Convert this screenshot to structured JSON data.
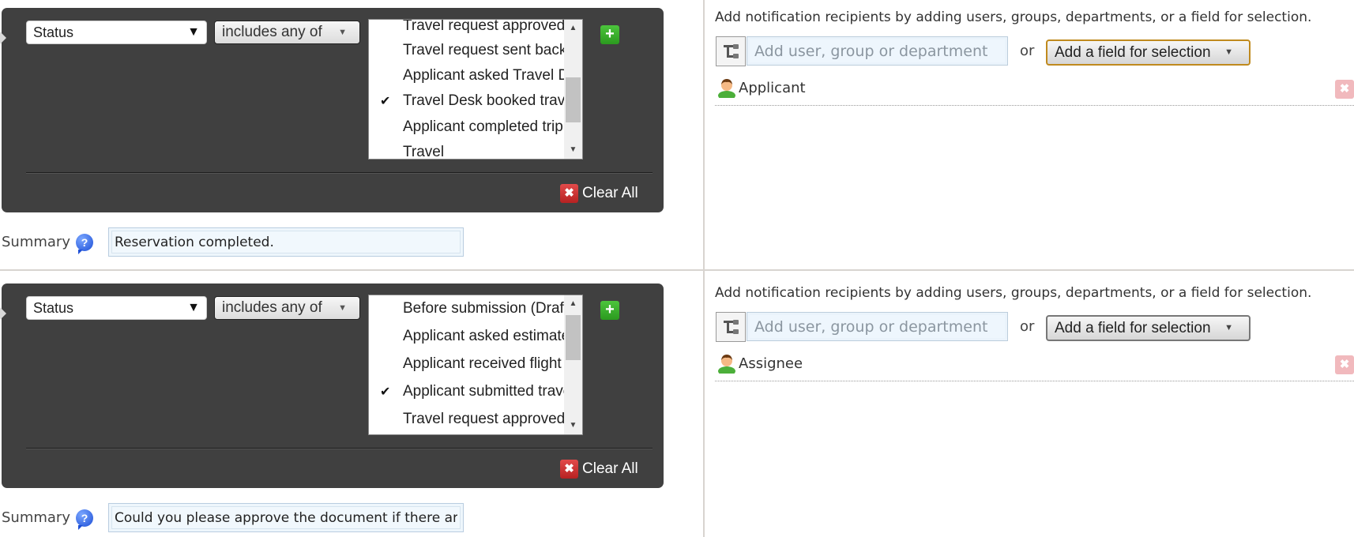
{
  "rules": [
    {
      "condition": {
        "field": "Status",
        "operator": "includes any of",
        "options": [
          {
            "label": "Travel request approved",
            "checked": false
          },
          {
            "label": "Travel request sent back",
            "checked": false
          },
          {
            "label": "Applicant asked Travel Desk",
            "checked": false
          },
          {
            "label": "Travel Desk booked travel",
            "checked": true
          },
          {
            "label": "Applicant completed trip",
            "checked": false
          },
          {
            "label": "Travel",
            "checked": false
          }
        ],
        "scroll_position": 0.55,
        "clear_all_label": "Clear All"
      },
      "summary": {
        "label": "Summary",
        "value": "Reservation completed."
      },
      "recipients": {
        "instructions": "Add notification recipients by adding users, groups, departments, or a field for selection.",
        "input_placeholder": "Add user, group or department",
        "or_label": "or",
        "field_button_label": "Add a field for selection",
        "list": [
          {
            "name": "Applicant"
          }
        ]
      }
    },
    {
      "condition": {
        "field": "Status",
        "operator": "includes any of",
        "options": [
          {
            "label": "Before submission (Draft)",
            "checked": false
          },
          {
            "label": "Applicant asked estimate",
            "checked": false
          },
          {
            "label": "Applicant received flight",
            "checked": false
          },
          {
            "label": "Applicant submitted travel",
            "checked": true
          },
          {
            "label": "Travel request approved",
            "checked": false
          }
        ],
        "scroll_position": 0.1,
        "clear_all_label": "Clear All"
      },
      "summary": {
        "label": "Summary",
        "value": "Could you please approve the document if there are"
      },
      "recipients": {
        "instructions": "Add notification recipients by adding users, groups, departments, or a field for selection.",
        "input_placeholder": "Add user, group or department",
        "or_label": "or",
        "field_button_label": "Add a field for selection",
        "list": [
          {
            "name": "Assignee"
          }
        ]
      }
    }
  ],
  "icons": {
    "dropdown": "▼",
    "small_dropdown": "▼",
    "check": "✔",
    "plus": "+",
    "clear": "✖",
    "help": "?",
    "remove": "✖",
    "scroll_up": "▲",
    "scroll_down": "▼"
  },
  "colors": {
    "panel_bg": "#404040",
    "add_button": "#34a825",
    "clear_button": "#c42a2a",
    "remove_button": "#f1b9bd",
    "input_bg": "#eef6fc",
    "focus_border": "#c08a1e"
  }
}
